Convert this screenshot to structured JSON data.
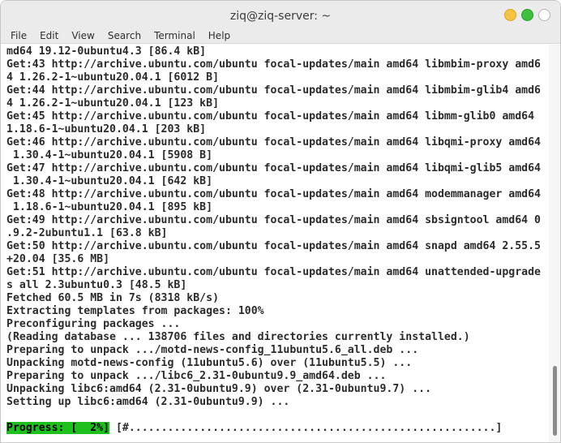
{
  "window": {
    "title": "ziq@ziq-server: ~"
  },
  "menu": {
    "items": [
      "File",
      "Edit",
      "View",
      "Search",
      "Terminal",
      "Help"
    ]
  },
  "terminal": {
    "lines": [
      "md64 19.12-0ubuntu4.3 [86.4 kB]",
      "Get:43 http://archive.ubuntu.com/ubuntu focal-updates/main amd64 libmbim-proxy amd6",
      "4 1.26.2-1~ubuntu20.04.1 [6012 B]",
      "Get:44 http://archive.ubuntu.com/ubuntu focal-updates/main amd64 libmbim-glib4 amd6",
      "4 1.26.2-1~ubuntu20.04.1 [123 kB]",
      "Get:45 http://archive.ubuntu.com/ubuntu focal-updates/main amd64 libmm-glib0 amd64",
      "1.18.6-1~ubuntu20.04.1 [203 kB]",
      "Get:46 http://archive.ubuntu.com/ubuntu focal-updates/main amd64 libqmi-proxy amd64",
      " 1.30.4-1~ubuntu20.04.1 [5908 B]",
      "Get:47 http://archive.ubuntu.com/ubuntu focal-updates/main amd64 libqmi-glib5 amd64",
      " 1.30.4-1~ubuntu20.04.1 [642 kB]",
      "Get:48 http://archive.ubuntu.com/ubuntu focal-updates/main amd64 modemmanager amd64",
      " 1.18.6-1~ubuntu20.04.1 [895 kB]",
      "Get:49 http://archive.ubuntu.com/ubuntu focal-updates/main amd64 sbsigntool amd64 0",
      ".9.2-2ubuntu1.1 [63.8 kB]",
      "Get:50 http://archive.ubuntu.com/ubuntu focal-updates/main amd64 snapd amd64 2.55.5",
      "+20.04 [35.6 MB]",
      "Get:51 http://archive.ubuntu.com/ubuntu focal-updates/main amd64 unattended-upgrade",
      "s all 2.3ubuntu0.3 [48.5 kB]",
      "Fetched 60.5 MB in 7s (8318 kB/s)",
      "Extracting templates from packages: 100%",
      "Preconfiguring packages ...",
      "(Reading database ... 138706 files and directories currently installed.)",
      "Preparing to unpack .../motd-news-config_11ubuntu5.6_all.deb ...",
      "Unpacking motd-news-config (11ubuntu5.6) over (11ubuntu5.5) ...",
      "Preparing to unpack .../libc6_2.31-0ubuntu9.9_amd64.deb ...",
      "Unpacking libc6:amd64 (2.31-0ubuntu9.9) over (2.31-0ubuntu9.7) ...",
      "Setting up libc6:amd64 (2.31-0ubuntu9.9) ..."
    ],
    "progress": {
      "label": "Progress: [  2%]",
      "bar": " [#.........................................................]",
      "percent": 2
    }
  },
  "colors": {
    "progress_highlight": "#1ec01e",
    "minimize": "#f5c242",
    "maximize": "#3fbf3f"
  }
}
